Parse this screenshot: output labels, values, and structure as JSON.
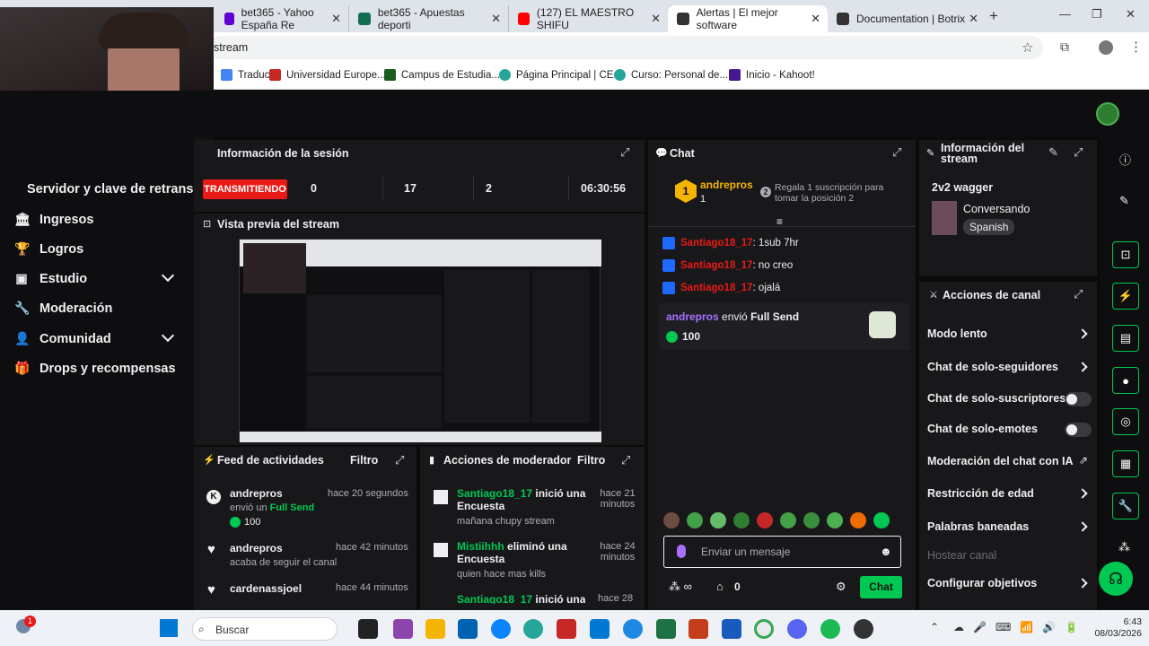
{
  "browser": {
    "tabs": [
      {
        "label": "bet365 - Yahoo España Re",
        "color": "#6001d2"
      },
      {
        "label": "bet365 - Apuestas deporti",
        "color": "#126e51"
      },
      {
        "label": "(127) EL MAESTRO SHIFU",
        "color": "#ff0000"
      },
      {
        "label": "Alertas | El mejor software",
        "color": "#333"
      },
      {
        "label": "Documentation | Botrix",
        "color": "#333"
      }
    ],
    "url": "stream",
    "bookmarks": [
      "Traducir",
      "Universidad Europe...",
      "Campus de Estudia...",
      "Página Principal | CE...",
      "Curso: Personal de...",
      "Inicio - Kahoot!"
    ]
  },
  "sidebar": {
    "header": "Servidor y clave de retransm",
    "items": [
      {
        "label": "Ingresos",
        "icon": "bank-icon"
      },
      {
        "label": "Logros",
        "icon": "trophy-icon"
      },
      {
        "label": "Estudio",
        "icon": "studio-icon",
        "expand": true
      },
      {
        "label": "Moderación",
        "icon": "wrench-icon"
      },
      {
        "label": "Comunidad",
        "icon": "person-icon",
        "expand": true
      },
      {
        "label": "Drops y recompensas",
        "icon": "gift-icon"
      }
    ]
  },
  "session": {
    "title": "Información de la sesión",
    "status": "TRANSMITIENDO",
    "stats": [
      "0",
      "17",
      "2",
      "06:30:56"
    ]
  },
  "preview": {
    "title": "Vista previa del stream"
  },
  "feed": {
    "title": "Feed de actividades",
    "filter": "Filtro",
    "items": [
      {
        "user": "andrepros",
        "time": "hace 20 segundos",
        "text": "envió un",
        "highlight": "Full Send",
        "value": "100"
      },
      {
        "user": "andrepros",
        "time": "hace 42 minutos",
        "text": "acaba de seguir el canal"
      },
      {
        "user": "cardenassjoel",
        "time": "hace 44 minutos",
        "text": ""
      }
    ]
  },
  "modactions": {
    "title": "Acciones de moderador",
    "filter": "Filtro",
    "items": [
      {
        "user": "Santiago18_17",
        "action": "inició una Encuesta",
        "time": "hace 21 minutos",
        "sub": "mañana chupy stream"
      },
      {
        "user": "Mistiihhh",
        "action": "eliminó una Encuesta",
        "time": "hace 24 minutos",
        "sub": "quien hace mas kills"
      },
      {
        "user": "Santiago18_17",
        "action": "inició una",
        "time": "hace 28"
      }
    ]
  },
  "chat": {
    "title": "Chat",
    "top_user": "andrepros",
    "top_count": "1",
    "gift_text": "Regala 1 suscripción para tomar la posición 2",
    "gift_count": "2",
    "messages": [
      {
        "user": "Santiago18_17",
        "text": ": 1sub 7hr"
      },
      {
        "user": "Santiago18_17",
        "text": ": no creo"
      },
      {
        "user": "Santiago18_17",
        "text": ": ojalá"
      }
    ],
    "event_user": "andrepros",
    "event_text": "envió",
    "event_item": "Full Send",
    "event_value": "100",
    "placeholder": "Enviar un mensaje",
    "points": "0",
    "send": "Chat"
  },
  "streaminfo": {
    "title": "Información del stream",
    "name": "2v2 wagger",
    "category": "Conversando",
    "lang": "Spanish"
  },
  "channel": {
    "title": "Acciones de canal",
    "items": [
      "Modo lento",
      "Chat de solo-seguidores",
      "Chat de solo-suscriptores",
      "Chat de solo-emotes",
      "Moderación del chat con IA",
      "Restricción de edad",
      "Palabras baneadas",
      "Hostear canal",
      "Configurar objetivos"
    ]
  },
  "taskbar": {
    "search": "Buscar",
    "time": "6:43",
    "date": "08/03/2026",
    "notif": "1"
  },
  "colors": {
    "accent": "#00c853",
    "live": "#e91916",
    "user": "#e91916",
    "purple": "#a970ff"
  }
}
